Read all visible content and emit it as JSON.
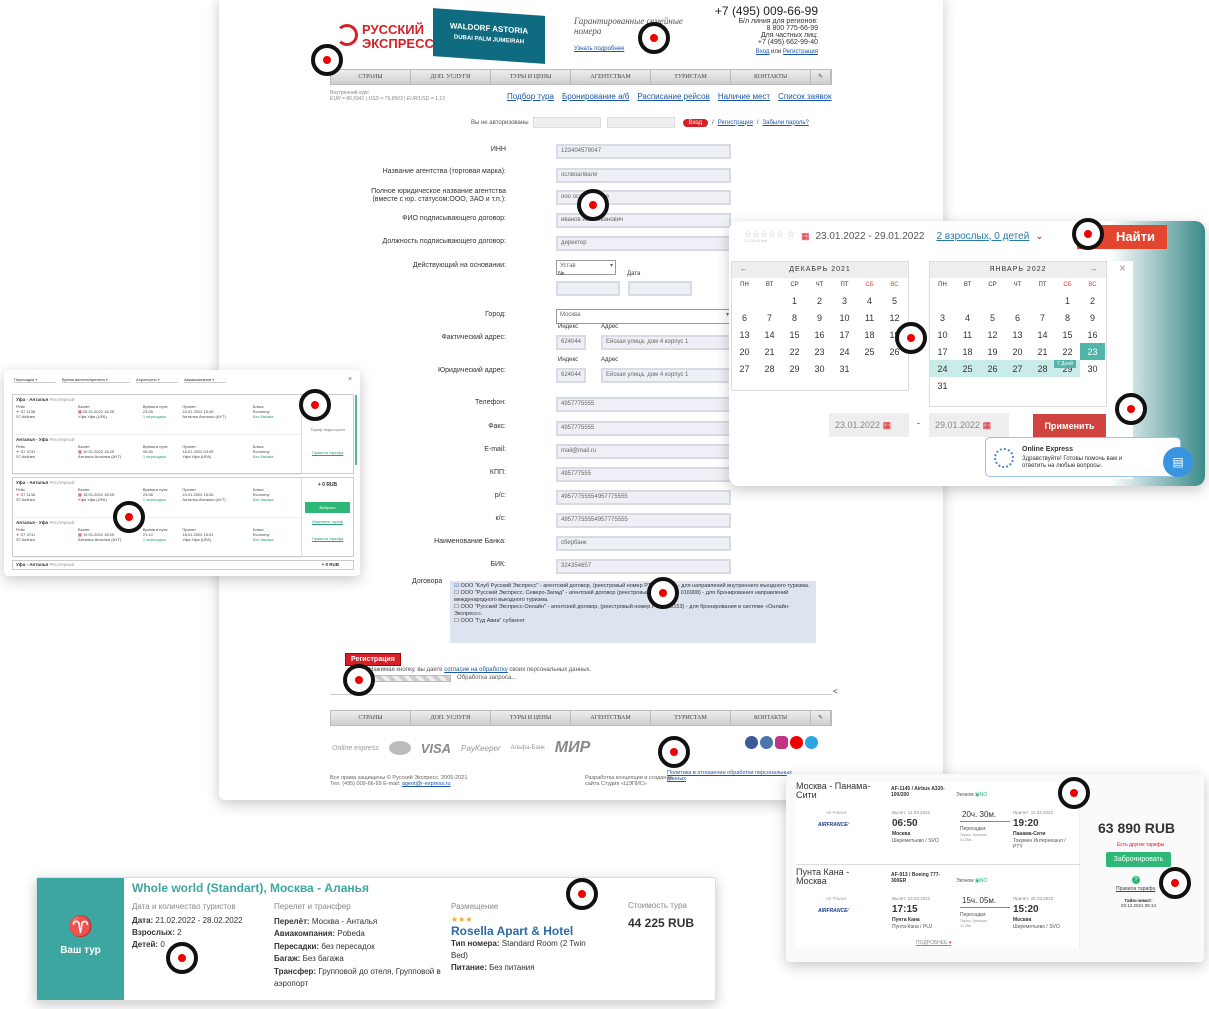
{
  "top": {
    "logo_line1": "РУССКИЙ",
    "logo_line2": "ЭКСПРЕСС",
    "banner_line1": "WALDORF ASTORIA",
    "banner_line2": "DUBAI PALM JUMEIRAH",
    "tagline": "Гарантированные семейные номера",
    "tagline_link": "Узнать подробнее",
    "phone": "+7 (495) 009-66-99",
    "phone_regions_label": "Б/л линия для регионов:",
    "phone_regions": "8 800 775-66-99",
    "private_label": "Для частных лиц:",
    "private_phone": "+7 (495) 662-99-40",
    "login": "Вход",
    "or": "или",
    "register": "Регистрация"
  },
  "nav": [
    "СТРАНЫ",
    "ДОП. УСЛУГИ",
    "ТУРЫ И ЦЕНЫ",
    "АГЕНТСТВАМ",
    "ТУРИСТАМ",
    "КОНТАКТЫ"
  ],
  "rates": {
    "label": "Внутренний курс",
    "text": "EUR = 86,5941 | USD = 76,8563 | EUR/USD = 1,13"
  },
  "quick_links": [
    "Подбор тура",
    "Бронирование а/б",
    "Расписание рейсов",
    "Наличие мест",
    "Список заявок"
  ],
  "auth": {
    "not_auth": "Вы не авторизованы",
    "login_btn": "Вход",
    "reg_link": "Регистрация",
    "forgot": "Забыли пароль?"
  },
  "form": {
    "inn": {
      "label": "ИНН",
      "value": "123404578047"
    },
    "agency": {
      "label": "Название агентства (торговая марка):",
      "value": "ослвоалвале"
    },
    "legal": {
      "label": "Полное юридическое название агентства (вместе с юр. статусом:ООО, ЗАО и т.п.):",
      "value": "ооо ослвоалвале"
    },
    "fio": {
      "label": "ФИО подписывающего договор:",
      "value": "иванов иван иванович"
    },
    "position": {
      "label": "Должность подписывающего договор:",
      "value": "директор"
    },
    "basis": {
      "label": "Действующий на основании:",
      "value": "Устав",
      "num_label": "№",
      "date_label": "Дата"
    },
    "city": {
      "label": "Город:",
      "value": "Москва"
    },
    "fact_addr": {
      "label": "Фактический адрес:",
      "index_label": "Индекс",
      "addr_label": "Адрес",
      "index": "624044",
      "addr": "Ейская улица, дом 4 корпус 1"
    },
    "legal_addr": {
      "label": "Юридический адрес:",
      "index_label": "Индекс",
      "addr_label": "Адрес",
      "index": "624044",
      "addr": "Ейская улица, дом 4 корпус 1"
    },
    "phone": {
      "label": "Телефон:",
      "value": "4957775555"
    },
    "fax": {
      "label": "Факс:",
      "value": "4957775555"
    },
    "email": {
      "label": "E-mail:",
      "value": "mail@mail.ru"
    },
    "kpp": {
      "label": "КПП:",
      "value": "495777555"
    },
    "rs": {
      "label": "р/с:",
      "value": "49577755554957775555"
    },
    "ks": {
      "label": "к/с:",
      "value": "49577755554957775555"
    },
    "bank": {
      "label": "Наименование Банка:",
      "value": "сбербанк"
    },
    "bik": {
      "label": "БИК:",
      "value": "324354657"
    },
    "contracts_label": "Договора",
    "contracts": [
      "ООО \"Клуб Русский Экспресс\" - агентский договор, (реестровый номер РТО 011884) - для направлений внутреннего въездного туризма.",
      "ООО \"Русский Экспресс. Северо-Запад\" - агентский договор (реестровый номер РТО 016908) - для бронирования направлений международного выездного туризма.",
      "ООО \"Русский Экспресс-Онлайн\" - агентский договор, (реестровый номер РТО 018153) - для бронирования в системе «Онлайн-Экспресс».",
      "ООО \"Гуд Авиа\" субагент"
    ],
    "submit": "Регистрация",
    "consent_pre": "Нажимая кнопку, вы даете ",
    "consent_link": "согласие на обработку",
    "consent_post": " своих персональных данных.",
    "processing": "Обработка запроса..."
  },
  "footer": {
    "copyright": "Все права защищены © Русский Экспресс, 2005-2021",
    "contacts_pre": "Тел. (495) 009-66-99 E-mail: ",
    "email": "agent@r-express.ru",
    "dev": "Разработка концепции и создание сайта Студия «ЦЭПИС»",
    "policy": "Политика в отношении обработки персональных данных",
    "pay": {
      "oe": "Online express",
      "visa": "VISA",
      "paykeeper": "PayKeeper",
      "alfa": "Альфа-Банк",
      "mir": "МИР"
    }
  },
  "flights_left": {
    "filters": [
      "Пересадки",
      "Время вылета/прилета",
      "Аэропорты",
      "Авиакомпании"
    ],
    "groups": [
      {
        "rows": [
          {
            "route": "Уфа - Анталья",
            "tag": "Регулярный",
            "flight": "S7 1136",
            "airline": "S7 Airlines",
            "dep_date": "25.01.2022",
            "dep_time": "16:25",
            "dep_ap": "Уфа Уфа (UFA)",
            "dur": "23:05",
            "stops": "1 пересадка",
            "arr_date": "24.01.2022",
            "arr_time": "15:30",
            "arr_ap": "Анталья Анталья (AYT)",
            "cls": "Economy",
            "bag": "Без багажа"
          },
          {
            "route": "Анталья - Уфа",
            "tag": "Регулярный",
            "flight": "S7 3741",
            "airline": "S7 Airlines",
            "dep_date": "19.01.2022",
            "dep_time": "16:25",
            "dep_ap": "Анталья Анталья (AYT)",
            "dur": "09:40",
            "stops": "1 пересадка",
            "arr_date": "18.01.2022",
            "arr_time": "04:05",
            "arr_ap": "Уфа Уфа (UFA)",
            "cls": "Economy",
            "bag": "Без багажа"
          }
        ],
        "note": "Тариф недоступен",
        "link": "Правила тарифа"
      },
      {
        "rows": [
          {
            "route": "Уфа - Анталья",
            "tag": "Регулярный",
            "flight": "S7 1136",
            "airline": "S7 Airlines",
            "dep_date": "15.01.2022",
            "dep_time": "16:25",
            "dep_ap": "Уфа Уфа (UFA)",
            "dur": "23:05",
            "stops": "1 пересадка",
            "arr_date": "24.01.2022",
            "arr_time": "15:30",
            "arr_ap": "Анталья Анталья (AYT)",
            "cls": "Economy",
            "bag": "Без багажа"
          },
          {
            "route": "Анталья - Уфа",
            "tag": "Регулярный",
            "flight": "S7 3741",
            "airline": "S7 Airlines",
            "dep_date": "19.01.2022",
            "dep_time": "16:25",
            "dep_ap": "Анталья Анталья (AYT)",
            "dur": "21:10",
            "stops": "1 пересадка",
            "arr_date": "18.01.2022",
            "arr_time": "15:01",
            "arr_ap": "Уфа Уфа (UFA)",
            "cls": "Economy",
            "bag": "Без багажа"
          }
        ],
        "price": "+ 0 RUB",
        "select": "Выбрать",
        "change": "Изменить тариф",
        "link": "Правила тарифа"
      }
    ],
    "partial_route": "Уфа - Анталья",
    "partial_tag": "Регулярный",
    "partial_price": "+ 0 RUB",
    "col": {
      "route": "Рейс",
      "dep": "Вылет",
      "dur": "Время в пути",
      "arr": "Прилет",
      "cls": "Класс"
    }
  },
  "calendar": {
    "stars_all": "все",
    "stars_nums": [
      "1",
      "2",
      "3",
      "4",
      "5"
    ],
    "dates": "23.01.2022 - 29.01.2022",
    "guests": "2 взрослых, 0 детей",
    "find": "Найти",
    "weekdays": [
      "ПН",
      "ВТ",
      "СР",
      "ЧТ",
      "ПТ",
      "СБ",
      "ВС"
    ],
    "month1": "ДЕКАБРЬ 2021",
    "month2": "ЯНВАРЬ 2022",
    "dec": [
      [
        "",
        "",
        "1",
        "2",
        "3",
        "4",
        "5"
      ],
      [
        "6",
        "7",
        "8",
        "9",
        "10",
        "11",
        "12"
      ],
      [
        "13",
        "14",
        "15",
        "16",
        "17",
        "18",
        "19"
      ],
      [
        "20",
        "21",
        "22",
        "23",
        "24",
        "25",
        "26"
      ],
      [
        "27",
        "28",
        "29",
        "30",
        "31",
        "",
        ""
      ]
    ],
    "jan": [
      [
        "",
        "",
        "",
        "",
        "",
        "1",
        "2"
      ],
      [
        "3",
        "4",
        "5",
        "6",
        "7",
        "8",
        "9"
      ],
      [
        "10",
        "11",
        "12",
        "13",
        "14",
        "15",
        "16"
      ],
      [
        "17",
        "18",
        "19",
        "20",
        "21",
        "22",
        "23"
      ],
      [
        "24",
        "25",
        "26",
        "27",
        "28",
        "29",
        "30"
      ],
      [
        "31",
        "",
        "",
        "",
        "",
        "",
        ""
      ]
    ],
    "nights": "7 Дней",
    "from": "23.01.2022",
    "to": "29.01.2022",
    "dash": "-",
    "apply": "Применить",
    "chat_title": "Online Express",
    "chat_text": "Здравствуйте! Готовы помочь вам и ответить на любые вопросы."
  },
  "flight_right": {
    "legs": [
      {
        "route": "Москва - Панама-Сити",
        "flight": "AF-1145 / Airbus A320-100/200",
        "cls": "Эконом",
        "bag": "NO",
        "carrier": "Air France",
        "logo": "AIRFRANCE",
        "dep_label": "Вылет: 11.03.2022",
        "dep_time": "06:50",
        "dep_city": "Москва",
        "dep_ap": "Шереметьево / SVO",
        "dur": "20ч. 30м.",
        "stop_label": "Пересадки:",
        "stop_city": "Париж, Франция",
        "stop_time": "3ч.35м.",
        "arr_label": "Прилет: 11.03.2022",
        "arr_time": "19:20",
        "arr_city": "Панама-Сити",
        "arr_ap": "Токумен Интернешнл / PTY"
      },
      {
        "route": "Пунта Кана - Москва",
        "flight": "AF-913 / Boeing 777-300ER",
        "cls": "Эконом",
        "bag": "NO",
        "carrier": "Air France",
        "logo": "AIRFRANCE",
        "dep_label": "Вылет: 24.03.2022",
        "dep_time": "17:15",
        "dep_city": "Пунта Кана",
        "dep_ap": "Пунта-Кана / PUJ",
        "dur": "15ч. 05м.",
        "stop_label": "Пересадки:",
        "stop_city": "Париж, Франция",
        "stop_time": "1ч.35м.",
        "arr_label": "Прилет: 25.03.2022",
        "arr_time": "15:20",
        "arr_city": "Москва",
        "arr_ap": "Шереметьево / SVO"
      }
    ],
    "price": "63 890 RUB",
    "other": "Есть другие тарифы",
    "book": "Забронировать",
    "rules": "Правила тарифа",
    "timelimit_label": "Тайм-лимит:",
    "timelimit": "03.12.2021 05:14",
    "more": "ПОДРОБНЕЕ"
  },
  "tour": {
    "icon_label": "Ваш тур",
    "title": "Whole world (Standart), Москва - Аланья",
    "c1_head": "Дата и количество туристов",
    "date_label": "Дата:",
    "date": "21.02.2022 - 28.02.2022",
    "adults_label": "Взрослых:",
    "adults": "2",
    "children_label": "Детей:",
    "children": "0",
    "c2_head": "Перелет и трансфер",
    "flight_label": "Перелёт:",
    "flight": "Москва - Анталья",
    "airline_label": "Авиакомпания:",
    "airline": "Pobeda",
    "stops_label": "Пересадки:",
    "stops": "без пересадок",
    "bag_label": "Багаж:",
    "bag": "Без багажа",
    "transfer_label": "Трансфер:",
    "transfer": "Групповой до отеля, Групповой в аэропорт",
    "c3_head": "Размещение",
    "hotel": "Rosella Apart & Hotel",
    "room_label": "Тип номера:",
    "room": "Standard Room (2 Twin Bed)",
    "meal_label": "Питание:",
    "meal": "Без питания",
    "c4_head": "Стоимость тура",
    "price": "44 225 RUB"
  }
}
